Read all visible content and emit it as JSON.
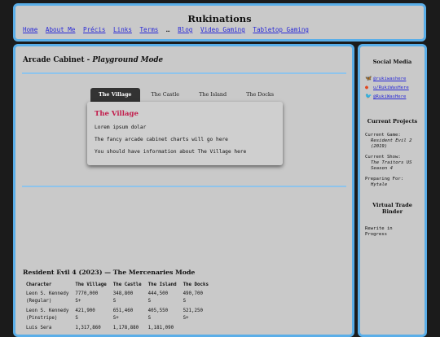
{
  "header": {
    "title": "Rukinations",
    "nav": [
      "Home",
      "About Me",
      "Précis",
      "Links",
      "Terms",
      "Blog",
      "Video Gaming",
      "Tabletop Gaming"
    ],
    "nav_separator": "…"
  },
  "main": {
    "title": "Arcade Cabinet",
    "title_sep": " - ",
    "subtitle": "Playground Mode",
    "tabs": [
      "The Village",
      "The Castle",
      "The Island",
      "The Docks"
    ],
    "active_tab": {
      "title": "The Village",
      "lines": [
        "Lorem ipsum dolar",
        "The fancy arcade cabinet charts will go here",
        "You should have information about The Village here"
      ]
    },
    "section_title": "Resident Evil 4 (2023) — The Mercenaries Mode",
    "table": {
      "headers": [
        "Character",
        "The Village",
        "The Castle",
        "The Island",
        "The Docks"
      ],
      "rows": [
        {
          "char_name": "Leon S. Kennedy",
          "char_variant": "(Regular)",
          "cells": [
            [
              "7770,000",
              "S+"
            ],
            [
              "348,800",
              "S"
            ],
            [
              "444,500",
              "S"
            ],
            [
              "490,700",
              "S"
            ]
          ]
        },
        {
          "char_name": "Leon S. Kennedy",
          "char_variant": "(Pinstripe)",
          "cells": [
            [
              "421,900",
              "S"
            ],
            [
              "651,460",
              "S+"
            ],
            [
              "405,550",
              "S"
            ],
            [
              "521,250",
              "S+"
            ]
          ]
        },
        {
          "char_name": "Luis Sera",
          "char_variant": "",
          "cells": [
            [
              "1,317,860",
              ""
            ],
            [
              "1,178,880",
              ""
            ],
            [
              "1,181,090",
              ""
            ],
            [
              "",
              ""
            ]
          ]
        }
      ]
    }
  },
  "sidebar": {
    "social_heading": "Social Media",
    "social": [
      {
        "icon": "bluesky-icon",
        "glyph": "🦋",
        "label": "@rukiwashere"
      },
      {
        "icon": "reddit-icon",
        "glyph": "●",
        "label": "u/RukiWasHere"
      },
      {
        "icon": "twitter-icon",
        "glyph": "🐦",
        "label": "@RukiWasHere"
      }
    ],
    "projects_heading": "Current Projects",
    "projects": [
      {
        "label": "Current Game:",
        "value": "Resident Evil 2 (2019)"
      },
      {
        "label": "Current Show:",
        "value": "The Traitors US Season 4"
      },
      {
        "label": "Preparing For:",
        "value": "Hytale"
      }
    ],
    "binder_heading": "Virtual Trade Binder",
    "binder_status": "Rewrite in Progress"
  },
  "colors": {
    "panel_bg": "#c9c9c9",
    "panel_border": "#5aaee8",
    "page_bg": "#1b1b1b",
    "link": "#2a2ad6",
    "tab_title": "#c21a4a"
  }
}
